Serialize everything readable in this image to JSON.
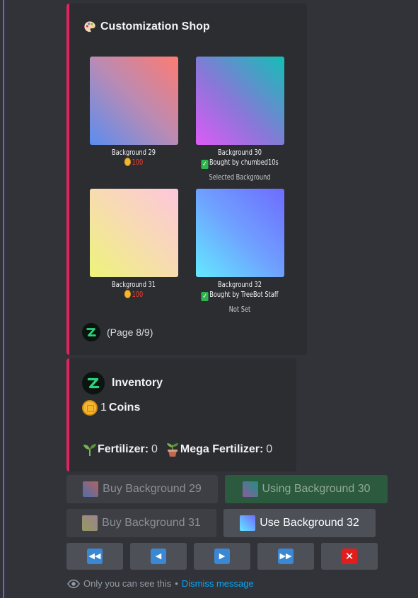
{
  "shop": {
    "title": "Customization Shop",
    "items": [
      {
        "name": "Background 29",
        "price": "100"
      },
      {
        "name": "Background 30",
        "owner": "Bought by chumbed10s",
        "status": "Selected Background"
      },
      {
        "name": "Background 31",
        "price": "100"
      },
      {
        "name": "Background 32",
        "owner": "Bought by TreeBot Staff",
        "status": "Not Set"
      }
    ],
    "page": "(Page 8/9)"
  },
  "inventory": {
    "title": "Inventory",
    "coins_value": "1",
    "coins_label": "Coins",
    "fertilizer_label": "Fertilizer:",
    "fertilizer_value": "0",
    "mega_label": "Mega Fertilizer:",
    "mega_value": "0"
  },
  "buttons": {
    "buy29": "Buy Background 29",
    "using30": "Using Background 30",
    "buy31": "Buy Background 31",
    "use32": "Use Background 32"
  },
  "footer": {
    "ephemeral_text": "Only you can see this",
    "separator": "•",
    "dismiss": "Dismiss message"
  },
  "colors": {
    "embed_accent": "#e0245e",
    "rail": "#5865f2",
    "link": "#00a8fc",
    "price": "#ff3b30"
  }
}
